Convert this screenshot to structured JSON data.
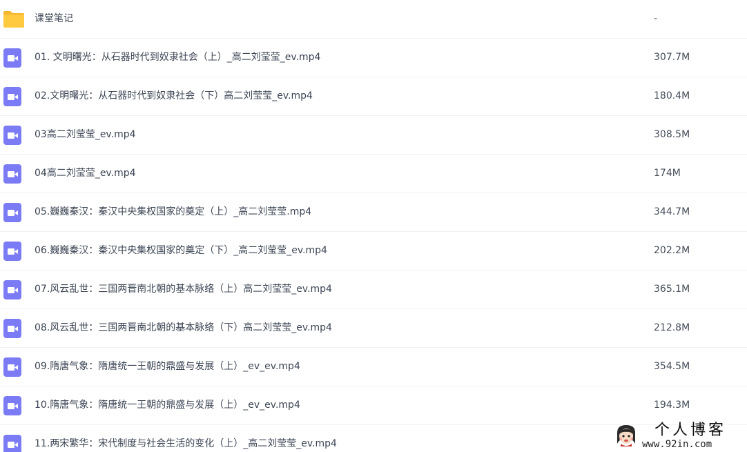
{
  "file_list": {
    "rows": [
      {
        "type": "folder",
        "icon": "folder-icon",
        "name": "课堂笔记",
        "size": "-"
      },
      {
        "type": "video",
        "icon": "video-file-icon",
        "name": "01. 文明曙光：从石器时代到奴隶社会（上）_高二刘莹莹_ev.mp4",
        "size": "307.7M"
      },
      {
        "type": "video",
        "icon": "video-file-icon",
        "name": "02.文明曙光：从石器时代到奴隶社会（下）高二刘莹莹_ev.mp4",
        "size": "180.4M"
      },
      {
        "type": "video",
        "icon": "video-file-icon",
        "name": "03高二刘莹莹_ev.mp4",
        "size": "308.5M"
      },
      {
        "type": "video",
        "icon": "video-file-icon",
        "name": "04高二刘莹莹_ev.mp4",
        "size": "174M"
      },
      {
        "type": "video",
        "icon": "video-file-icon",
        "name": "05.巍巍秦汉：秦汉中央集权国家的奠定（上）_高二刘莹莹.mp4",
        "size": "344.7M"
      },
      {
        "type": "video",
        "icon": "video-file-icon",
        "name": "06.巍巍秦汉：秦汉中央集权国家的奠定（下）_高二刘莹莹_ev.mp4",
        "size": "202.2M"
      },
      {
        "type": "video",
        "icon": "video-file-icon",
        "name": "07.风云乱世：三国两晋南北朝的基本脉络（上）高二刘莹莹_ev.mp4",
        "size": "365.1M"
      },
      {
        "type": "video",
        "icon": "video-file-icon",
        "name": "08.风云乱世：三国两晋南北朝的基本脉络（下）高二刘莹莹_ev.mp4",
        "size": "212.8M"
      },
      {
        "type": "video",
        "icon": "video-file-icon",
        "name": "09.隋唐气象：隋唐统一王朝的鼎盛与发展（上）_ev_ev.mp4",
        "size": "354.5M"
      },
      {
        "type": "video",
        "icon": "video-file-icon",
        "name": "10.隋唐气象：隋唐统一王朝的鼎盛与发展（上）_ev_ev.mp4",
        "size": "194.3M"
      },
      {
        "type": "video",
        "icon": "video-file-icon",
        "name": "11.两宋繁华：宋代制度与社会生活的变化（上）_高二刘莹莹_ev.mp4",
        "size": ""
      }
    ]
  },
  "watermark": {
    "title": "个人博客",
    "url": "www.92in.com"
  },
  "colors": {
    "folder": "#ffc940",
    "folder_tab": "#f5b52c",
    "video_icon": "#7b7cf5",
    "row_divider": "#f1f2f4",
    "text": "#3c4554"
  }
}
